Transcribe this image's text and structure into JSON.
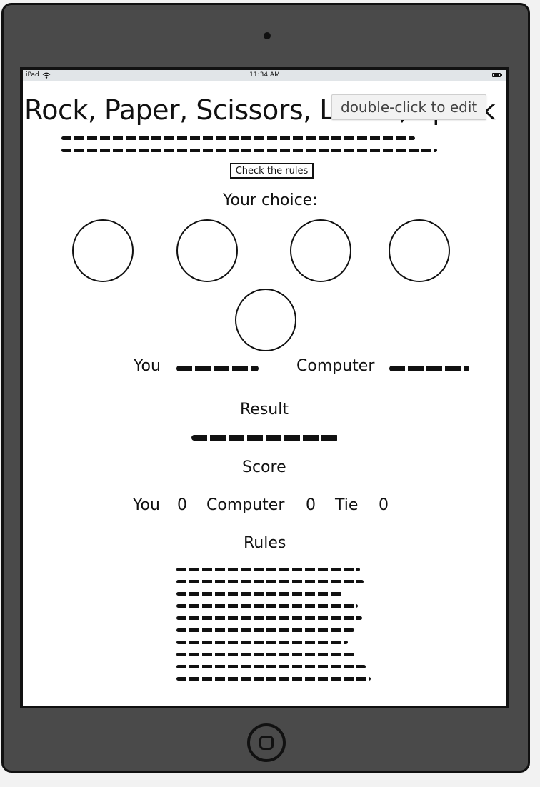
{
  "status_bar": {
    "device": "iPad",
    "time": "11:34 AM"
  },
  "header": {
    "title": "Rock, Paper, Scissors, Lizard, Spock",
    "tooltip": "double-click to edit"
  },
  "rules_button": {
    "label": "Check the rules"
  },
  "choice_section": {
    "heading": "Your choice:"
  },
  "round": {
    "you_label": "You",
    "computer_label": "Computer"
  },
  "result": {
    "heading": "Result"
  },
  "score": {
    "heading": "Score",
    "you_label": "You",
    "you_value": "0",
    "computer_label": "Computer",
    "computer_value": "0",
    "tie_label": "Tie",
    "tie_value": "0"
  },
  "rules": {
    "heading": "Rules"
  },
  "icons": {
    "wifi": "wifi-icon",
    "battery": "battery-icon",
    "home": "home-button-icon",
    "camera": "camera-icon"
  },
  "colors": {
    "frame": "#4a4a4a",
    "status_bar": "#e1e5e8",
    "ink": "#111111"
  }
}
